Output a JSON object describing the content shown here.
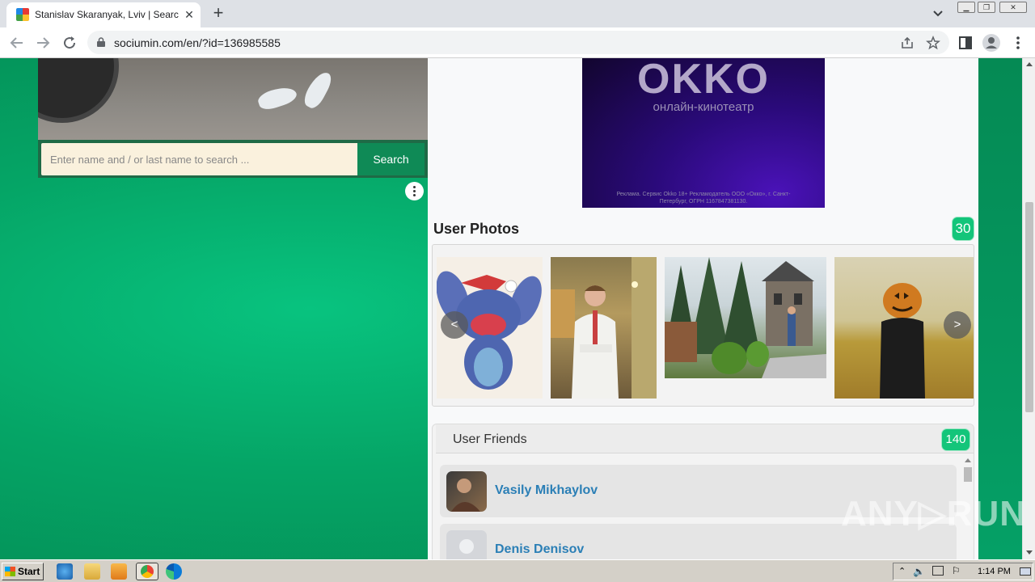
{
  "browser": {
    "tab_title": "Stanislav Skaranyak, Lviv | Search In",
    "url": "sociumin.com/en/?id=136985585",
    "new_tab_symbol": "+",
    "close_symbol": "✕"
  },
  "search": {
    "placeholder": "Enter name and / or last name to search ...",
    "button_label": "Search"
  },
  "ad": {
    "logo": "OKKO",
    "subtitle": "онлайн-кинотеатр",
    "fine_print": "Реклама. Сервис Okko 18+ Рекламодатель ООО «Окко», г. Санкт-Петербург, ОГРН 1167847381130."
  },
  "photos": {
    "title": "User Photos",
    "count": "30",
    "prev": "<",
    "next": ">"
  },
  "friends": {
    "title": "User Friends",
    "count": "140",
    "items": [
      {
        "name": "Vasily Mikhaylov"
      },
      {
        "name": "Denis Denisov"
      }
    ]
  },
  "watermark": "ANY▷RUN",
  "taskbar": {
    "start_label": "Start",
    "clock": "1:14 PM"
  }
}
